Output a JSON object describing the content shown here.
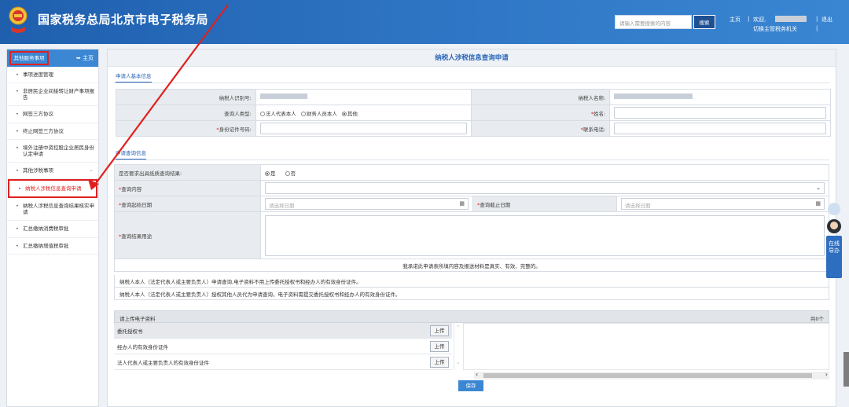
{
  "header": {
    "site_title": "国家税务总局北京市电子税务局",
    "search_placeholder": "请输入需要搜索的内容",
    "search_button": "搜索",
    "home_link": "主页",
    "welcome": "欢迎,",
    "logout": "退出",
    "switch_org": "切换主管税务机关",
    "sep": "|"
  },
  "sidebar": {
    "category": "其他服务事项",
    "home": "主页",
    "items": [
      {
        "label": "事项进度管理"
      },
      {
        "label": "非居民企业间接转让财产事项报告"
      },
      {
        "label": "网签三方协议"
      },
      {
        "label": "终止网签三方协议"
      },
      {
        "label": "境外注册中资控股企业居民身份认定申请"
      },
      {
        "label": "其他涉税事项"
      },
      {
        "label": "纳税人涉税信息查询申请"
      },
      {
        "label": "纳税人涉税信息查询结果核实申请"
      },
      {
        "label": "汇总缴纳消费税审批"
      },
      {
        "label": "汇总缴纳增值税审批"
      }
    ]
  },
  "main": {
    "title": "纳税人涉税信息查询申请",
    "basic_section": "申请人基本信息",
    "query_section": "申请查询信息",
    "fields": {
      "taxpayer_id": "纳税人识别号:",
      "taxpayer_name": "纳税人名称:",
      "requester_type": "查询人类型:",
      "requester_options": [
        "法人代表本人",
        "财务人员本人",
        "其他"
      ],
      "name": "姓名:",
      "id_number": "身份证件号码:",
      "phone": "联系电话:",
      "paper_result": "是否要求出具纸质查询结果:",
      "yes": "是",
      "no": "否",
      "query_content": "查询内容",
      "start_date": "查询起始日期",
      "end_date": "查询截止日期",
      "date_placeholder": "请选择日期",
      "purpose": "查询结果用途"
    },
    "req_mark": "*",
    "declaration": "我承诺此申请表所填内容及报送材料是真实、有效、完整的。",
    "note1": "纳税人本人（法定代表人或主要负责人）申请查询,电子资料不用上传委托授权书和经办人的有效身份证件。",
    "note2": "纳税人本人（法定代表人或主要负责人）授权其他人员代为申请查询，电子资料需提交委托授权书和经办人的有效身份证件。",
    "upload": {
      "title": "请上传电子资料",
      "count": "共0个",
      "button": "上传",
      "rows": [
        {
          "label": "委托授权书"
        },
        {
          "label": "经办人的有效身份证件"
        },
        {
          "label": "法人代表人或主要负责人的有效身份证件"
        }
      ]
    },
    "save_button": "保存"
  },
  "right_rail": {
    "label": "在线导办"
  },
  "colors": {
    "header_blue": "#2f77c6",
    "accent_blue": "#3b87d4",
    "annotation_red": "#e02020"
  }
}
